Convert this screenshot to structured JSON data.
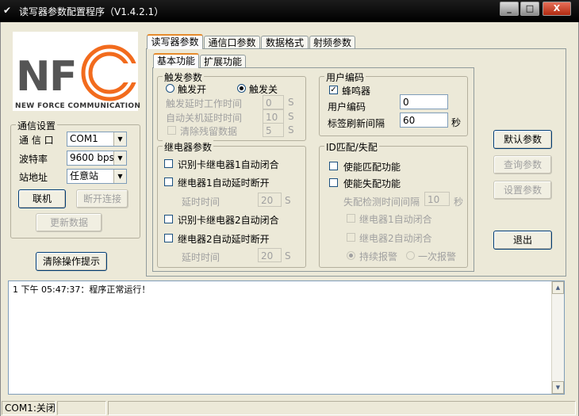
{
  "window": {
    "title": "读写器参数配置程序（V1.4.2.1）",
    "min_label": "_",
    "max_label": "□",
    "close_label": "X"
  },
  "logo": {
    "text": "NFC",
    "subtitle": "NEW FORCE COMMUNICATION",
    "letter_color": "#555555",
    "c_color": "#f26b1d"
  },
  "comm": {
    "legend": "通信设置",
    "port_label": "通 信 口",
    "port_value": "COM1",
    "baud_label": "波特率",
    "baud_value": "9600 bps",
    "station_label": "站地址",
    "station_value": "任意站",
    "connect_btn": "联机",
    "disconnect_btn": "断开连接",
    "update_btn": "更新数据"
  },
  "clear_btn": "清除操作提示",
  "tabs": [
    "读写器参数",
    "通信口参数",
    "数据格式",
    "射频参数"
  ],
  "subtabs": [
    "基本功能",
    "扩展功能"
  ],
  "trigger": {
    "legend": "触发参数",
    "on_label": "触发开",
    "off_label": "触发关",
    "delay_label": "触发延时工作时间",
    "delay_value": "0",
    "auto_off_label": "自动关机延时时间",
    "auto_off_value": "10",
    "clear_label": "清除残留数据",
    "clear_value": "5",
    "unit": "S"
  },
  "user": {
    "legend": "用户编码",
    "buzzer_label": "蜂鸣器",
    "code_label": "用户编码",
    "code_value": "0",
    "refresh_label": "标签刷新间隔",
    "refresh_value": "60",
    "refresh_unit": "秒"
  },
  "relay": {
    "legend": "继电器参数",
    "r1_auto_close": "识别卡继电器1自动闭合",
    "r1_delay_open": "继电器1自动延时断开",
    "r1_delay_label": "延时时间",
    "r1_delay_value": "20",
    "r2_auto_close": "识别卡继电器2自动闭合",
    "r2_delay_open": "继电器2自动延时断开",
    "r2_delay_label": "延时时间",
    "r2_delay_value": "20",
    "unit": "S"
  },
  "id_match": {
    "legend": "ID匹配/失配",
    "match_label": "使能匹配功能",
    "mismatch_label": "使能失配功能",
    "interval_label": "失配检测时间间隔",
    "interval_value": "10",
    "interval_unit": "秒",
    "r1_close": "继电器1自动闭合",
    "r2_close": "继电器2自动闭合",
    "continuous_alarm": "持续报警",
    "single_alarm": "一次报警"
  },
  "right_buttons": {
    "default": "默认参数",
    "query": "查询参数",
    "set": "设置参数",
    "exit": "退出"
  },
  "log": {
    "line1": "1  下午 05:47:37：程序正常运行！"
  },
  "status": {
    "port": "COM1:关闭",
    "cell2": "",
    "cell3": ""
  }
}
